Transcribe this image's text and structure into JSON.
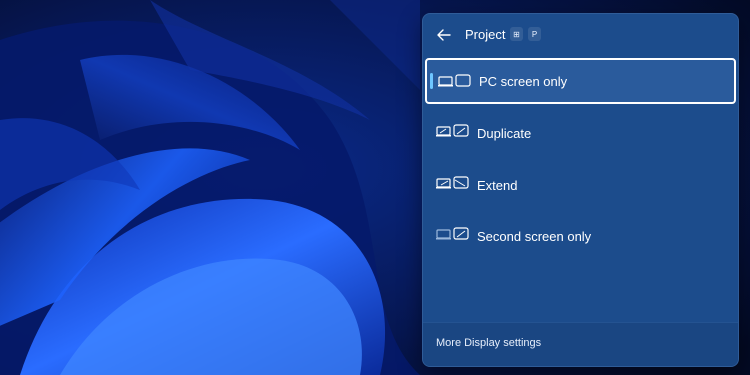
{
  "panel": {
    "title": "Project",
    "shortcut_keys": [
      "⊞",
      "P"
    ],
    "options": [
      {
        "label": "PC screen only",
        "icon": "pc-screen-only-icon",
        "selected": true
      },
      {
        "label": "Duplicate",
        "icon": "duplicate-icon",
        "selected": false
      },
      {
        "label": "Extend",
        "icon": "extend-icon",
        "selected": false
      },
      {
        "label": "Second screen only",
        "icon": "second-screen-only-icon",
        "selected": false
      }
    ],
    "footer_link": "More Display settings"
  },
  "colors": {
    "panel_bg": "#1c4c8c",
    "selected_bg": "#2a5b9c",
    "accent": "#6ec6ff"
  }
}
